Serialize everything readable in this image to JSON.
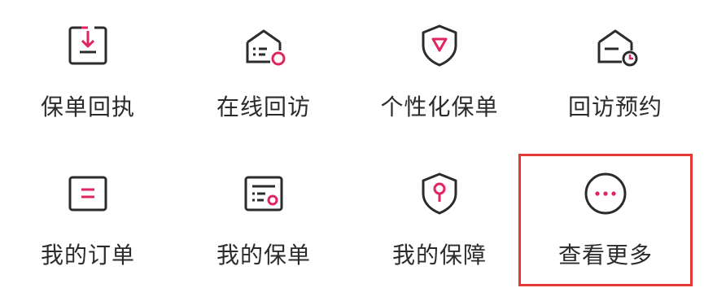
{
  "colors": {
    "dark": "#2b2b2b",
    "accent": "#e0245e",
    "highlight": "#e53935"
  },
  "menu": {
    "items": [
      {
        "label": "保单回执",
        "icon": "policy-receipt-icon"
      },
      {
        "label": "在线回访",
        "icon": "online-visit-icon"
      },
      {
        "label": "个性化保单",
        "icon": "custom-policy-shield-icon"
      },
      {
        "label": "回访预约",
        "icon": "visit-appointment-icon"
      },
      {
        "label": "我的订单",
        "icon": "my-orders-icon"
      },
      {
        "label": "我的保单",
        "icon": "my-policies-icon"
      },
      {
        "label": "我的保障",
        "icon": "my-coverage-shield-icon"
      },
      {
        "label": "查看更多",
        "icon": "more-dots-icon"
      }
    ]
  }
}
